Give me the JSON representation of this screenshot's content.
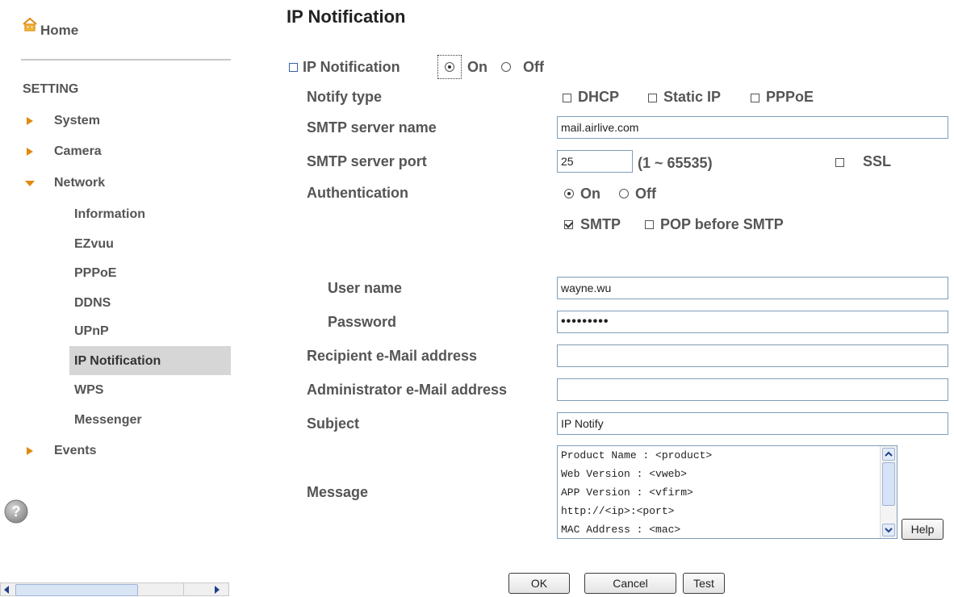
{
  "sidebar": {
    "home_label": "Home",
    "setting_header": "SETTING",
    "items": [
      {
        "label": "System",
        "expanded": false
      },
      {
        "label": "Camera",
        "expanded": false
      },
      {
        "label": "Network",
        "expanded": true
      },
      {
        "label": "Events",
        "expanded": false
      }
    ],
    "network_subitems": [
      "Information",
      "EZvuu",
      "PPPoE",
      "DDNS",
      "UPnP",
      "IP Notification",
      "WPS",
      "Messenger"
    ],
    "active_subitem": "IP Notification"
  },
  "main": {
    "title": "IP Notification",
    "ip_notification_label": "IP Notification",
    "ip_notification_on": "On",
    "ip_notification_off": "Off",
    "ip_notification_state": "On",
    "notify_type_label": "Notify type",
    "notify_options": [
      {
        "label": "DHCP",
        "checked": false
      },
      {
        "label": "Static IP",
        "checked": false
      },
      {
        "label": "PPPoE",
        "checked": false
      }
    ],
    "smtp_server_name_label": "SMTP server name",
    "smtp_server_name_value": "mail.airlive.com",
    "smtp_server_port_label": "SMTP server port",
    "smtp_server_port_value": "25",
    "smtp_port_range": "(1 ~ 65535)",
    "ssl_label": "SSL",
    "ssl_checked": false,
    "authentication_label": "Authentication",
    "auth_on": "On",
    "auth_off": "Off",
    "auth_state": "On",
    "auth_smtp_label": "SMTP",
    "auth_smtp_checked": true,
    "auth_pop_label": "POP before SMTP",
    "auth_pop_checked": false,
    "user_name_label": "User name",
    "user_name_value": "wayne.wu",
    "password_label": "Password",
    "password_value": "•••••••••",
    "recipient_label": "Recipient e-Mail address",
    "recipient_value": "",
    "admin_email_label": "Administrator e-Mail address",
    "admin_email_value": "",
    "subject_label": "Subject",
    "subject_value": "IP Notify",
    "message_label": "Message",
    "message_lines": [
      "Product Name : <product>",
      "Web Version : <vweb>",
      "APP Version : <vfirm>",
      "http://<ip>:<port>",
      "MAC Address : <mac>"
    ],
    "help_button": "Help",
    "ok_button": "OK",
    "cancel_button": "Cancel",
    "test_button": "Test"
  },
  "colors": {
    "accent_arrow": "#e08a10",
    "active_bg": "#d6d6d6",
    "label_text": "#555555"
  }
}
